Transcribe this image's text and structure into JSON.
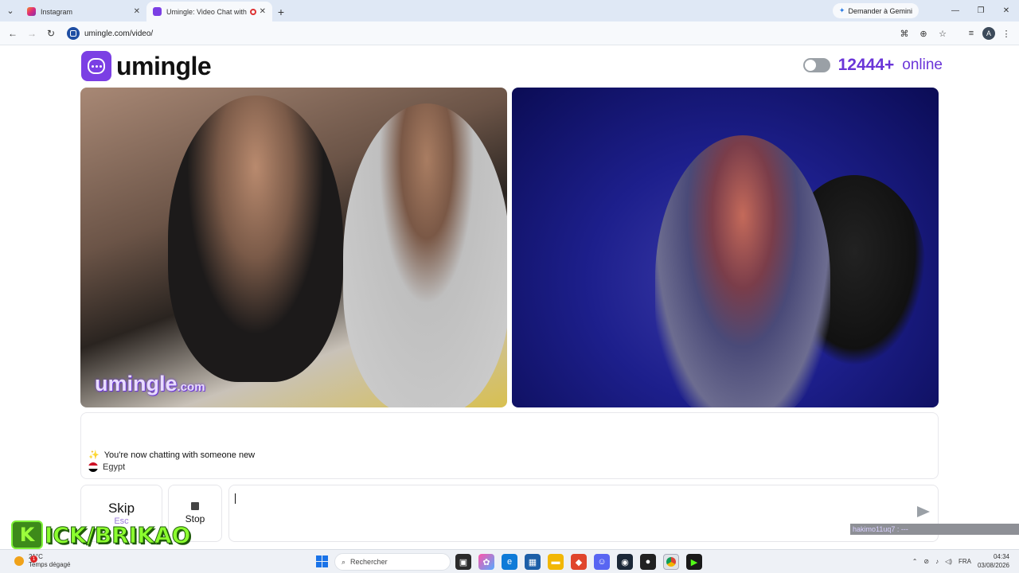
{
  "browser": {
    "tabs": [
      {
        "title": "Instagram",
        "active": false
      },
      {
        "title": "Umingle: Video Chat with S",
        "active": true
      }
    ],
    "gemini_label": "Demander à Gemini",
    "url": "umingle.com/video/",
    "profile_initial": "A"
  },
  "site": {
    "logo_text": "umingle",
    "online_count": "12444+",
    "online_label": "online",
    "watermark_main": "umingle",
    "watermark_suffix": ".com"
  },
  "chat": {
    "status_message": "You're now chatting with someone new",
    "country": "Egypt"
  },
  "controls": {
    "skip_label": "Skip",
    "skip_key": "Esc",
    "stop_label": "Stop"
  },
  "overlay": {
    "kick_letter": "K",
    "kick_text": "ICK/BRIKAO",
    "kick_username": "hakimo11uq7 : ---"
  },
  "taskbar": {
    "weather_temp": "21°C",
    "weather_desc": "Temps dégagé",
    "search_placeholder": "Rechercher",
    "language": "FRA",
    "time": "04:34",
    "date": "03/08/2026"
  },
  "colors": {
    "brand": "#6a35d8",
    "logo_bg": "#7b3fe4"
  }
}
